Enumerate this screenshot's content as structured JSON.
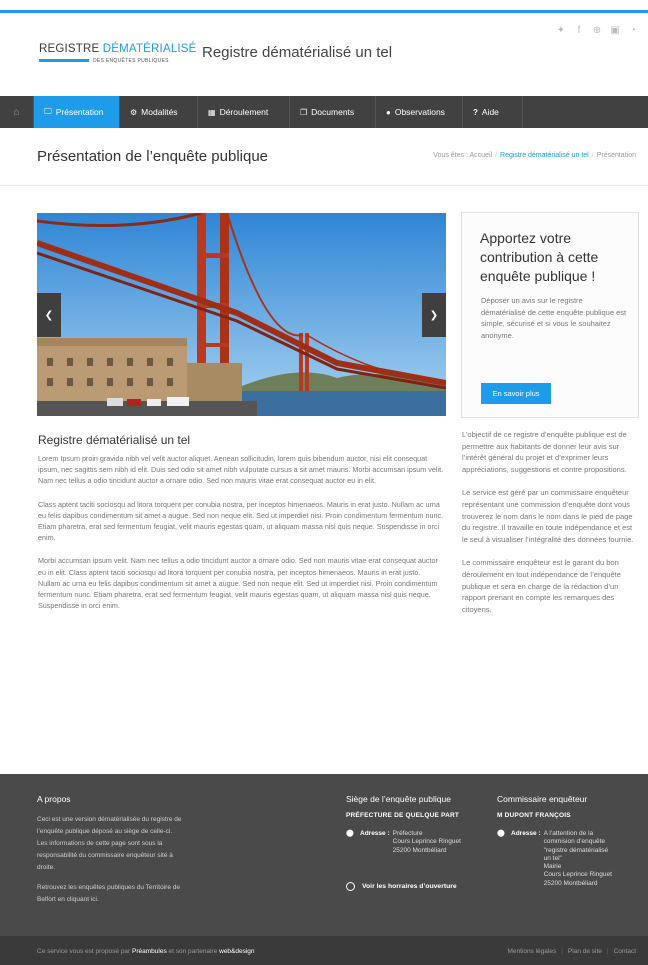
{
  "social": [
    "twitter-icon",
    "facebook-icon",
    "google-plus-icon",
    "linkedin-icon",
    "rss-icon"
  ],
  "logo": {
    "line1_a": "REGISTRE ",
    "line1_b": "DÉMATÉRIALISÉ",
    "line2": "DES ENQUÊTES PUBLIQUES"
  },
  "site_title": "Registre dématérialisé un tel",
  "nav": {
    "items": [
      {
        "label": "Présentation",
        "icon": "monitor-icon",
        "glyph": "🖵"
      },
      {
        "label": "Modalités",
        "icon": "cogs-icon",
        "glyph": "⚙"
      },
      {
        "label": "Déroulement",
        "icon": "calendar-icon",
        "glyph": "▦"
      },
      {
        "label": "Documents",
        "icon": "documents-icon",
        "glyph": "❐"
      },
      {
        "label": "Observations",
        "icon": "comments-icon",
        "glyph": "●"
      },
      {
        "label": "Aide",
        "icon": "question-icon",
        "glyph": "?"
      }
    ]
  },
  "page_title": "Présentation de l’enquête publique",
  "breadcrumb": {
    "prefix": "Vous êtes :",
    "home": "Accueil",
    "parent": "Registre dématérialisé un tel",
    "current": "Présentation"
  },
  "article": {
    "title": "Registre dématérialisé un tel",
    "paragraphs": [
      "Lorem Ipsum proin gravida nibh vel velit auctor aliquet. Aenean sollicitudin, lorem quis bibendum auctor, nisi elit consequat ipsum, nec sagittis sem nibh id elit. Duis sed odio sit amet nibh vulputate cursus a sit amet mauris. Morbi accumsan ipsum velit. Nam nec tellus a odio tincidunt auctor a ornare odio. Sed non  mauris vitae erat consequat auctor eu in elit.",
      "Class aptent taciti sociosqu ad litora torquent per conubia nostra, per inceptos himenaeos. Mauris in erat justo. Nullam ac urna eu felis dapibus condimentum sit amet a augue. Sed non neque elit. Sed ut imperdiet nisi. Proin condimentum fermentum nunc. Etiam pharetra, erat sed fermentum feugiat, velit mauris egestas quam, ut aliquam massa nisl quis neque. Suspendisse in orci enim.",
      "Morbi accumsan ipsum velit. Nam nec tellus a odio tincidunt auctor a ornare odio. Sed non  mauris vitae erat consequat auctor eu in elit. Class aptent taciti sociosqu ad litora torquent per conubia nostra, per inceptos himenaeos. Mauris in erat justo. Nullam ac urna eu felis dapibus condimentum sit amet a augue. Sed non neque elit. Sed ut imperdiet nisi. Proin condimentum fermentum nunc. Etiam pharetra, erat sed fermentum feugiat, velit mauris egestas quam, ut aliquam massa nisl quis neque. Suspendisse in orci enim."
    ]
  },
  "cta": {
    "title": "Apportez votre contribution à cette enquête publique !",
    "text": "Déposer un avis sur le registre dématérialisé de cette enquête publique est simple, sécurisé et si vous le souhaitez anonyme.",
    "button": "En savoir plus"
  },
  "sidebar": {
    "paragraphs": [
      "L’objectif de ce registre d’enquête publique est de permettre aux habitants de donner leur avis sur l’intérêt général du projet et d’exprimer leurs appréciations, suggestions et contre propositions.",
      "Le service est géré par un commissaire enquêteur représentant une commission d’enquête dont vous trouverez le nom dans le nom dans le pied de page du registre. Il travaille en toute indépendance et est le seul à visualiser l’intégralité des données fournie.",
      "Le commissaire enquêteur est le garant du bon déroulement en tout indépendance de l’enquête publique  et sera en charge de la rédaction d’un rapport prenant en compte les remarques des citoyens."
    ]
  },
  "footer": {
    "about": {
      "title": "A propos",
      "p1": "Ceci est une version dématérialisée du registre de l’enquête publique déposé au siège de celle-ci. Les informations de cette page sont sous la responsabilité du commissaire enquêteur sité à droite.",
      "p2": "Retrouvez les enquêtes publiques du Territoire de Belfort en cliquant ici."
    },
    "seat": {
      "title": "Siège de l’enquête publique",
      "sub": "PRÉFECTURE DE QUELQUE PART",
      "addr_label": "Adresse :",
      "addr_lines": [
        "Préfecture",
        "Cours Leprince Ringuet",
        "25200 Montbéliard"
      ],
      "hours": "Voir les horraires d’ouverture"
    },
    "commissioner": {
      "title": "Commissaire enquêteur",
      "sub": "M DUPONT FRANÇOIS",
      "addr_label": "Adresse :",
      "addr_lines": [
        "A l’attention de la",
        "commision d’enquête",
        "\"registre dématérialisé",
        "un tel\"",
        "Mairie",
        "Cours Leprince Ringuet",
        "25200 Montbéliard"
      ]
    }
  },
  "bottom": {
    "credit_a": "Ce service vous est proposé par ",
    "credit_b": "Préambules",
    "credit_c": " et son partenaire ",
    "credit_d": "web&design",
    "links": [
      "Mentions légales",
      "Plan de site",
      "Contact"
    ]
  }
}
